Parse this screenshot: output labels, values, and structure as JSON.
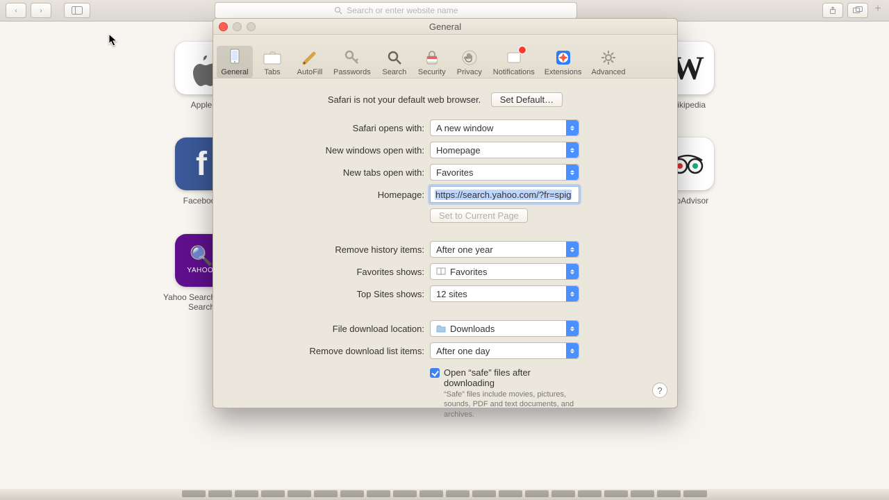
{
  "safari": {
    "url_placeholder": "Search or enter website name",
    "favorites": [
      [
        {
          "k": "apple",
          "label": "Apple",
          "glyph": ""
        },
        {
          "k": "wiki",
          "label": "Wikipedia",
          "glyph": "W"
        }
      ],
      [
        {
          "k": "fb",
          "label": "Facebook",
          "glyph": "f"
        },
        {
          "k": "ta",
          "label": "TripAdvisor",
          "glyph": "ⓞⓞ"
        }
      ],
      [
        {
          "k": "yahoo",
          "label": "Yahoo Search · Web Search",
          "glyph": "🔍",
          "sublabel": "YAHOO!"
        }
      ]
    ]
  },
  "prefs": {
    "title": "General",
    "tabs": [
      "General",
      "Tabs",
      "AutoFill",
      "Passwords",
      "Search",
      "Security",
      "Privacy",
      "Notifications",
      "Extensions",
      "Advanced"
    ],
    "default_msg": "Safari is not your default web browser.",
    "set_default_btn": "Set Default…",
    "labels": {
      "opens_with": "Safari opens with:",
      "new_windows": "New windows open with:",
      "new_tabs": "New tabs open with:",
      "homepage": "Homepage:",
      "current_page": "Set to Current Page",
      "remove_history": "Remove history items:",
      "fav_shows": "Favorites shows:",
      "top_sites": "Top Sites shows:",
      "dl_location": "File download location:",
      "remove_dl": "Remove download list items:"
    },
    "values": {
      "opens_with": "A new window",
      "new_windows": "Homepage",
      "new_tabs": "Favorites",
      "homepage": "https://search.yahoo.com/?fr=spig",
      "remove_history": "After one year",
      "fav_shows": "Favorites",
      "top_sites": "12 sites",
      "dl_location": "Downloads",
      "remove_dl": "After one day"
    },
    "open_safe_label": "Open “safe” files after downloading",
    "open_safe_hint": "“Safe” files include movies, pictures, sounds, PDF and text documents, and archives."
  }
}
